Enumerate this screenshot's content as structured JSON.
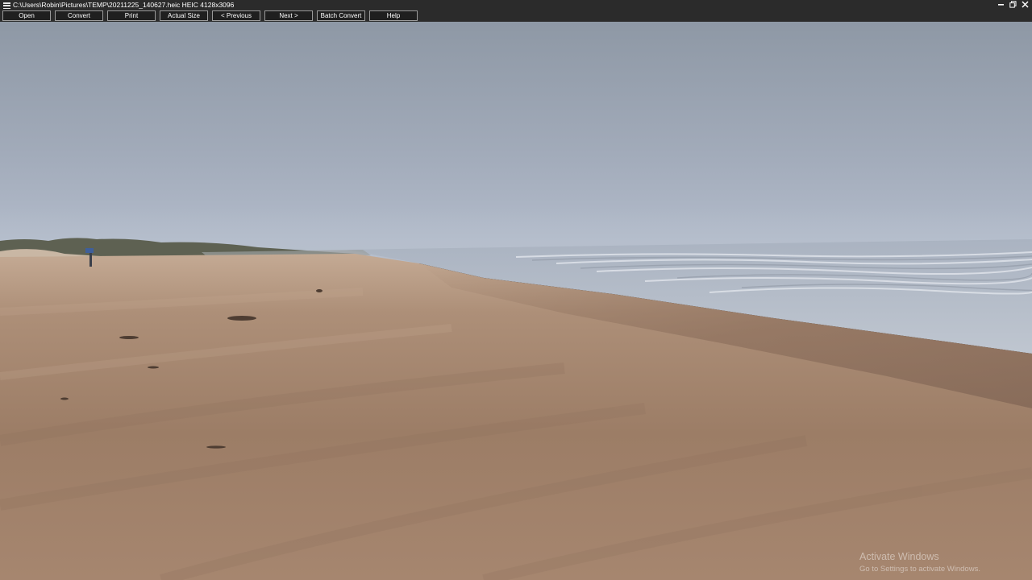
{
  "window": {
    "title": "C:\\Users\\Robin\\Pictures\\TEMP\\20211225_140627.heic HEIC 4128x3096",
    "controls": {
      "minimize_icon": "minimize-icon",
      "maximize_icon": "maximize-icon",
      "close_icon": "close-icon"
    }
  },
  "toolbar": {
    "buttons": [
      {
        "label": "Open"
      },
      {
        "label": "Convert"
      },
      {
        "label": "Print"
      },
      {
        "label": "Actual Size"
      },
      {
        "label": "< Previous"
      },
      {
        "label": "Next >"
      },
      {
        "label": "Batch Convert"
      },
      {
        "label": "Help"
      }
    ]
  },
  "watermark": {
    "title": "Activate Windows",
    "subtitle": "Go to Settings to activate Windows."
  },
  "colors": {
    "titlebar": "#2b2b2b",
    "sky_top": "#8d97a4",
    "sky_horizon": "#b3bccb",
    "sand_light": "#bfa18a",
    "sand_dark": "#94755f",
    "water": "#b8bfca"
  }
}
